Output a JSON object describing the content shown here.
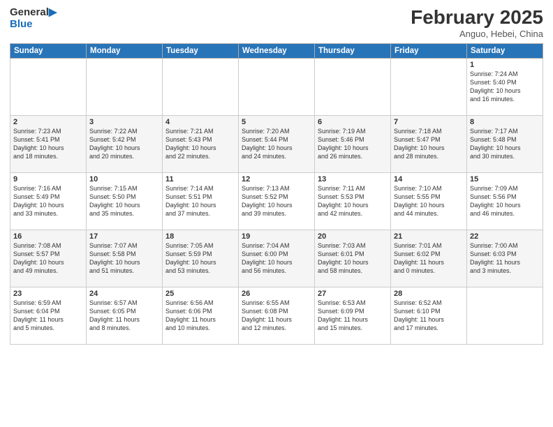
{
  "header": {
    "title": "February 2025",
    "subtitle": "Anguo, Hebei, China"
  },
  "columns": [
    "Sunday",
    "Monday",
    "Tuesday",
    "Wednesday",
    "Thursday",
    "Friday",
    "Saturday"
  ],
  "weeks": [
    [
      {
        "day": "",
        "info": ""
      },
      {
        "day": "",
        "info": ""
      },
      {
        "day": "",
        "info": ""
      },
      {
        "day": "",
        "info": ""
      },
      {
        "day": "",
        "info": ""
      },
      {
        "day": "",
        "info": ""
      },
      {
        "day": "1",
        "info": "Sunrise: 7:24 AM\nSunset: 5:40 PM\nDaylight: 10 hours\nand 16 minutes."
      }
    ],
    [
      {
        "day": "2",
        "info": "Sunrise: 7:23 AM\nSunset: 5:41 PM\nDaylight: 10 hours\nand 18 minutes."
      },
      {
        "day": "3",
        "info": "Sunrise: 7:22 AM\nSunset: 5:42 PM\nDaylight: 10 hours\nand 20 minutes."
      },
      {
        "day": "4",
        "info": "Sunrise: 7:21 AM\nSunset: 5:43 PM\nDaylight: 10 hours\nand 22 minutes."
      },
      {
        "day": "5",
        "info": "Sunrise: 7:20 AM\nSunset: 5:44 PM\nDaylight: 10 hours\nand 24 minutes."
      },
      {
        "day": "6",
        "info": "Sunrise: 7:19 AM\nSunset: 5:46 PM\nDaylight: 10 hours\nand 26 minutes."
      },
      {
        "day": "7",
        "info": "Sunrise: 7:18 AM\nSunset: 5:47 PM\nDaylight: 10 hours\nand 28 minutes."
      },
      {
        "day": "8",
        "info": "Sunrise: 7:17 AM\nSunset: 5:48 PM\nDaylight: 10 hours\nand 30 minutes."
      }
    ],
    [
      {
        "day": "9",
        "info": "Sunrise: 7:16 AM\nSunset: 5:49 PM\nDaylight: 10 hours\nand 33 minutes."
      },
      {
        "day": "10",
        "info": "Sunrise: 7:15 AM\nSunset: 5:50 PM\nDaylight: 10 hours\nand 35 minutes."
      },
      {
        "day": "11",
        "info": "Sunrise: 7:14 AM\nSunset: 5:51 PM\nDaylight: 10 hours\nand 37 minutes."
      },
      {
        "day": "12",
        "info": "Sunrise: 7:13 AM\nSunset: 5:52 PM\nDaylight: 10 hours\nand 39 minutes."
      },
      {
        "day": "13",
        "info": "Sunrise: 7:11 AM\nSunset: 5:53 PM\nDaylight: 10 hours\nand 42 minutes."
      },
      {
        "day": "14",
        "info": "Sunrise: 7:10 AM\nSunset: 5:55 PM\nDaylight: 10 hours\nand 44 minutes."
      },
      {
        "day": "15",
        "info": "Sunrise: 7:09 AM\nSunset: 5:56 PM\nDaylight: 10 hours\nand 46 minutes."
      }
    ],
    [
      {
        "day": "16",
        "info": "Sunrise: 7:08 AM\nSunset: 5:57 PM\nDaylight: 10 hours\nand 49 minutes."
      },
      {
        "day": "17",
        "info": "Sunrise: 7:07 AM\nSunset: 5:58 PM\nDaylight: 10 hours\nand 51 minutes."
      },
      {
        "day": "18",
        "info": "Sunrise: 7:05 AM\nSunset: 5:59 PM\nDaylight: 10 hours\nand 53 minutes."
      },
      {
        "day": "19",
        "info": "Sunrise: 7:04 AM\nSunset: 6:00 PM\nDaylight: 10 hours\nand 56 minutes."
      },
      {
        "day": "20",
        "info": "Sunrise: 7:03 AM\nSunset: 6:01 PM\nDaylight: 10 hours\nand 58 minutes."
      },
      {
        "day": "21",
        "info": "Sunrise: 7:01 AM\nSunset: 6:02 PM\nDaylight: 11 hours\nand 0 minutes."
      },
      {
        "day": "22",
        "info": "Sunrise: 7:00 AM\nSunset: 6:03 PM\nDaylight: 11 hours\nand 3 minutes."
      }
    ],
    [
      {
        "day": "23",
        "info": "Sunrise: 6:59 AM\nSunset: 6:04 PM\nDaylight: 11 hours\nand 5 minutes."
      },
      {
        "day": "24",
        "info": "Sunrise: 6:57 AM\nSunset: 6:05 PM\nDaylight: 11 hours\nand 8 minutes."
      },
      {
        "day": "25",
        "info": "Sunrise: 6:56 AM\nSunset: 6:06 PM\nDaylight: 11 hours\nand 10 minutes."
      },
      {
        "day": "26",
        "info": "Sunrise: 6:55 AM\nSunset: 6:08 PM\nDaylight: 11 hours\nand 12 minutes."
      },
      {
        "day": "27",
        "info": "Sunrise: 6:53 AM\nSunset: 6:09 PM\nDaylight: 11 hours\nand 15 minutes."
      },
      {
        "day": "28",
        "info": "Sunrise: 6:52 AM\nSunset: 6:10 PM\nDaylight: 11 hours\nand 17 minutes."
      },
      {
        "day": "",
        "info": ""
      }
    ]
  ]
}
